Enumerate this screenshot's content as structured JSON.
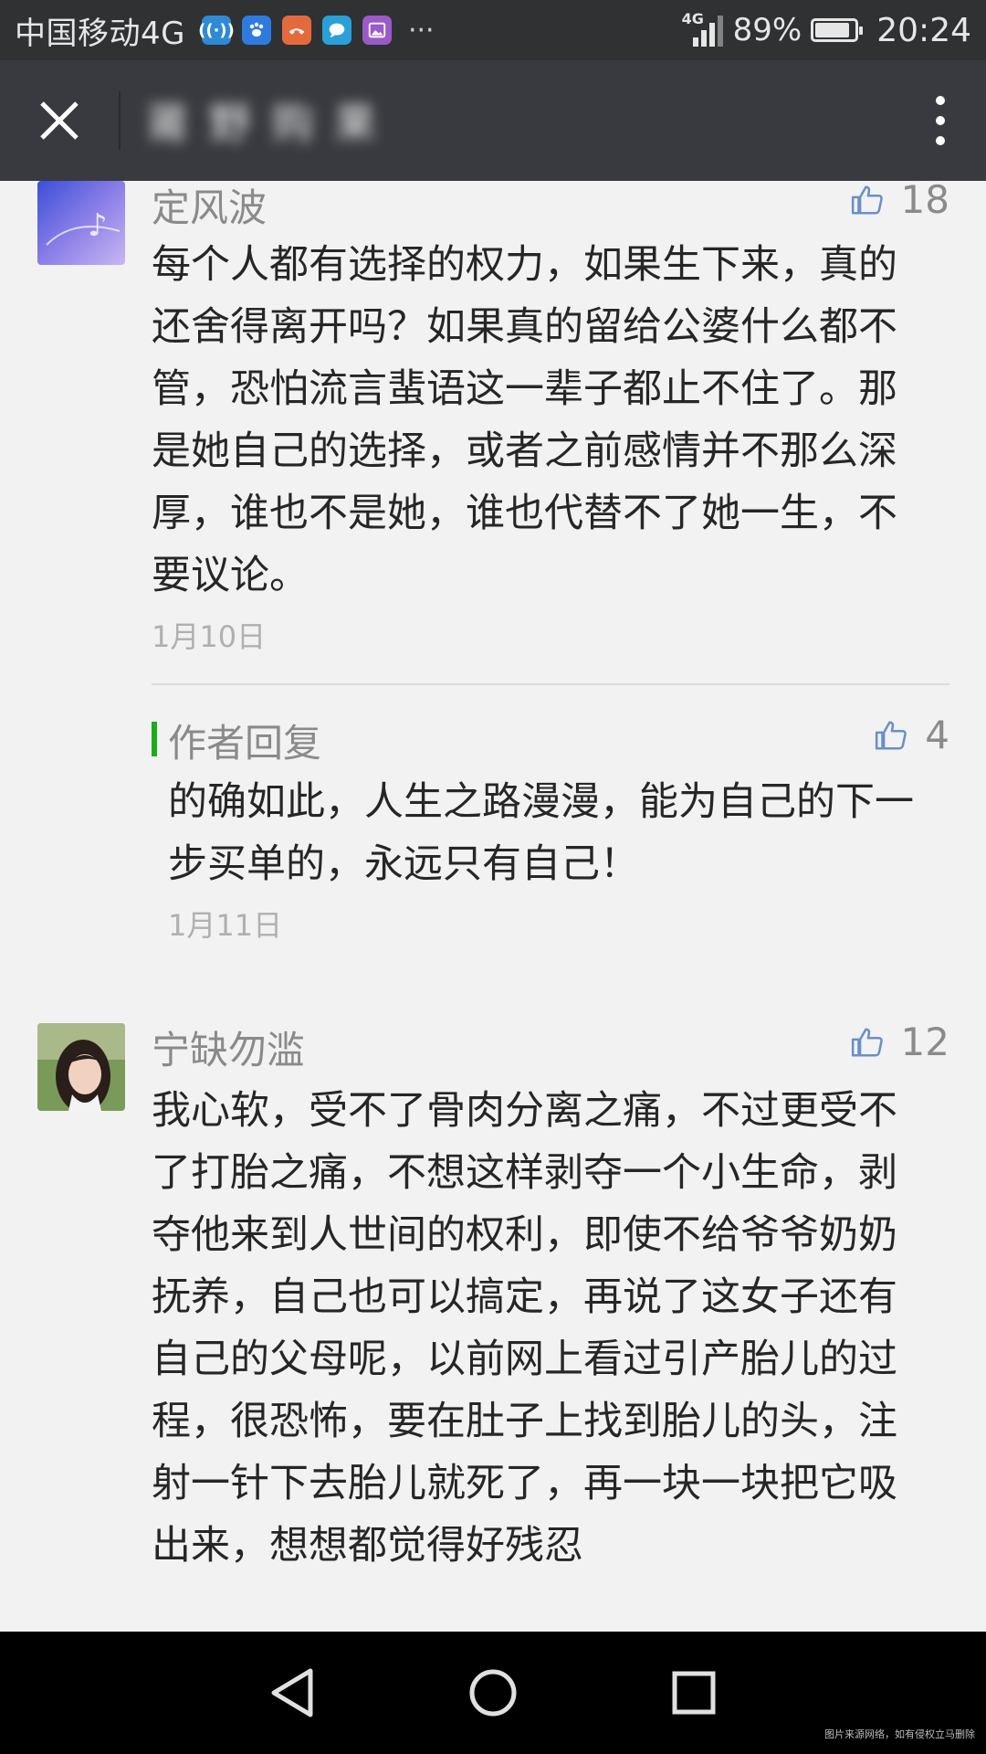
{
  "status_bar": {
    "carrier": "中国移动4G",
    "overflow": "···",
    "network": "4G",
    "battery_percent": "89%",
    "battery_level": 0.89,
    "time": "20:24"
  },
  "nav": {
    "title": "莆 野 购 果",
    "close_icon": "close-icon",
    "more_icon": "more-vertical-icon"
  },
  "comments": [
    {
      "user": "定风波",
      "likes": "18",
      "text": "每个人都有选择的权力，如果生下来，真的还舍得离开吗？如果真的留给公婆什么都不管，恐怕流言蜚语这一辈子都止不住了。那是她自己的选择，或者之前感情并不那么深厚，谁也不是她，谁也代替不了她一生，不要议论。",
      "date": "1月10日",
      "reply": {
        "label": "作者回复",
        "likes": "4",
        "text": "的确如此，人生之路漫漫，能为自己的下一步买单的，永远只有自己！",
        "date": "1月11日"
      }
    },
    {
      "user": "宁缺勿滥",
      "likes": "12",
      "text": "我心软，受不了骨肉分离之痛，不过更受不了打胎之痛，不想这样剥夺一个小生命，剥夺他来到人世间的权利，即使不给爷爷奶奶抚养，自己也可以搞定，再说了这女子还有自己的父母呢，以前网上看过引产胎儿的过程，很恐怖，要在肚子上找到胎儿的头，注射一针下去胎儿就死了，再一块一块把它吸出来，想想都觉得好残忍"
    }
  ],
  "watermark": "图片来源网络，如有侵权立马删除",
  "colors": {
    "status_bar": "#2f3133",
    "nav_bar": "#393a3f",
    "background": "#f2f2f2",
    "reply_accent": "#1aad19"
  }
}
